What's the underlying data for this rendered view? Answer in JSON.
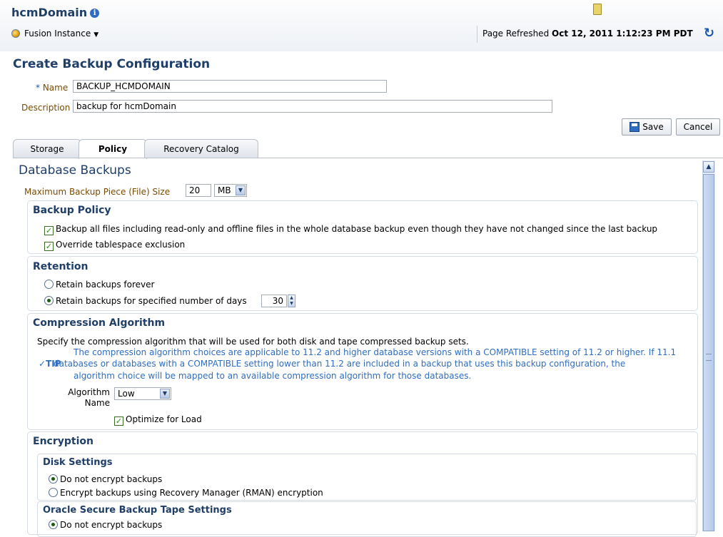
{
  "header": {
    "domain_title": "hcmDomain",
    "info_icon": "i",
    "instance_label": "Fusion Instance",
    "refreshed_prefix": "Page Refreshed",
    "refreshed_time": "Oct 12, 2011 1:12:23 PM PDT"
  },
  "page_title": "Create Backup Configuration",
  "form": {
    "name_required": "*",
    "name_label": "Name",
    "name_value": "BACKUP_HCMDOMAIN",
    "description_label": "Description",
    "description_value": "backup for hcmDomain"
  },
  "buttons": {
    "save": "Save",
    "cancel": "Cancel"
  },
  "tabs": [
    {
      "label": "Storage"
    },
    {
      "label": "Policy"
    },
    {
      "label": "Recovery Catalog"
    }
  ],
  "database_backups": {
    "heading": "Database Backups",
    "max_piece_label": "Maximum Backup Piece (File) Size",
    "max_piece_value": "20",
    "max_piece_unit": "MB"
  },
  "backup_policy": {
    "heading": "Backup Policy",
    "backup_all_label": "Backup all files including read-only and offline files in the whole database backup even though they have not changed since the last backup",
    "override_label": "Override tablespace exclusion"
  },
  "retention": {
    "heading": "Retention",
    "forever_label": "Retain backups forever",
    "days_label": "Retain backups for specified number of days",
    "days_value": "30"
  },
  "compression": {
    "heading": "Compression Algorithm",
    "description": "Specify the compression algorithm that will be used for both disk and tape compressed backup sets.",
    "tip_label": "TIP",
    "tip_line1": "The compression algorithm choices are applicable to 11.2 and higher database versions with a COMPATIBLE setting of 11.2 or higher. If 11.1",
    "tip_line2": "databases or databases with a COMPATIBLE setting lower than 11.2 are included in a backup that uses this backup configuration, the",
    "tip_line3": "algorithm choice will be mapped to an available compression algorithm for those databases.",
    "algorithm_label_1": "Algorithm",
    "algorithm_label_2": "Name",
    "algorithm_value": "Low",
    "optimize_label": "Optimize for Load"
  },
  "encryption": {
    "heading": "Encryption",
    "disk_heading": "Disk Settings",
    "disk_no_encrypt": "Do not encrypt backups",
    "disk_rman_encrypt": "Encrypt backups using Recovery Manager (RMAN) encryption",
    "tape_heading": "Oracle Secure Backup Tape Settings",
    "tape_no_encrypt": "Do not encrypt backups"
  }
}
